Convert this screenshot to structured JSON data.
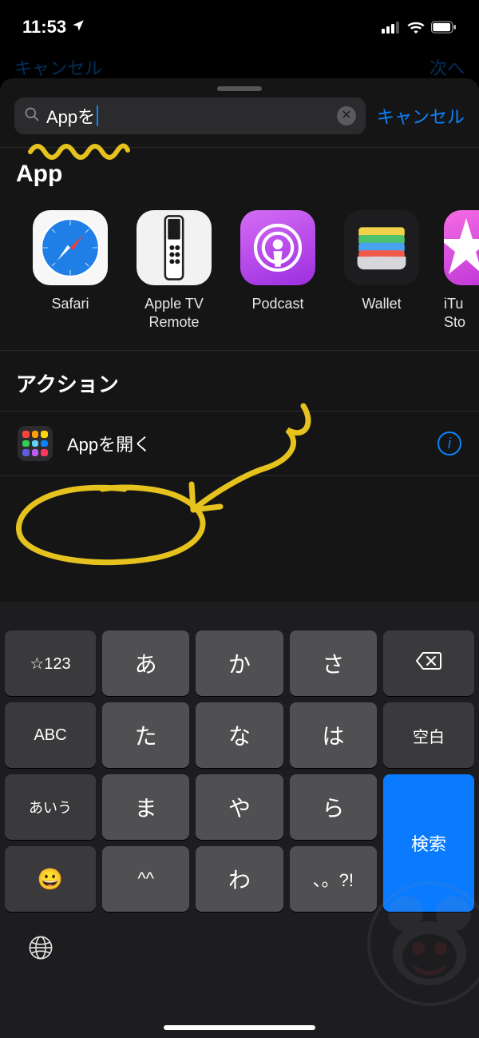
{
  "status": {
    "time": "11:53",
    "location_icon": "location-arrow-icon",
    "signal_icon": "cellular-signal-icon",
    "wifi_icon": "wifi-icon",
    "battery_icon": "battery-icon"
  },
  "under_sheet": {
    "back": "キャンセル",
    "next": "次へ"
  },
  "search": {
    "value": "Appを",
    "clear_glyph": "✕",
    "cancel": "キャンセル",
    "search_icon": "search-icon"
  },
  "apps": {
    "heading": "App",
    "items": [
      {
        "id": "safari",
        "label": "Safari"
      },
      {
        "id": "appletv-remote",
        "label": "Apple TV Remote"
      },
      {
        "id": "podcast",
        "label": "Podcast"
      },
      {
        "id": "wallet",
        "label": "Wallet"
      },
      {
        "id": "itunes-store",
        "label": "iTunes Store",
        "label_cut": "iTu\nSto"
      }
    ]
  },
  "actions": {
    "heading": "アクション",
    "items": [
      {
        "id": "open-app",
        "label": "Appを開く",
        "info": "i"
      }
    ]
  },
  "keyboard": {
    "keys": {
      "k_num": "☆123",
      "k_a": "あ",
      "k_ka": "か",
      "k_sa": "さ",
      "k_abc": "ABC",
      "k_ta": "た",
      "k_na": "な",
      "k_ha": "は",
      "k_space": "空白",
      "k_aiu": "あいう",
      "k_ma": "ま",
      "k_ya": "や",
      "k_ra": "ら",
      "k_search": "検索",
      "k_emoji": "😀",
      "k_face": "^^",
      "k_wa": "わ",
      "k_punct": "、。?!",
      "k_del_icon": "delete-icon"
    },
    "globe_icon": "globe-icon"
  },
  "colors": {
    "accent": "#0a84ff",
    "annotation": "#e5c21d"
  }
}
